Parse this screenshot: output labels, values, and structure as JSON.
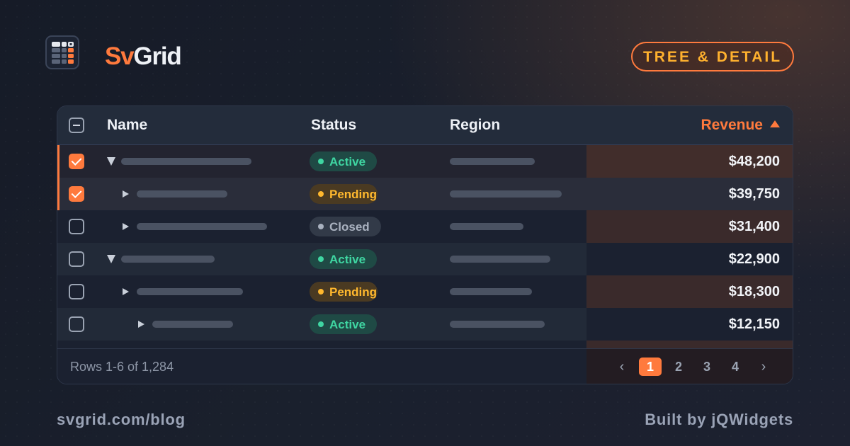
{
  "brand": {
    "accent": "Sv",
    "rest": "Grid",
    "badge": "TREE & DETAIL"
  },
  "colors": {
    "accent": "#ff7a3d",
    "badge_text": "#ffb12e",
    "active": "#3fd6a2",
    "pending": "#ffb82e",
    "closed": "#a9b1bf"
  },
  "grid": {
    "columns": {
      "name": "Name",
      "status": "Status",
      "region": "Region",
      "revenue": "Revenue"
    },
    "sort": {
      "column": "revenue",
      "direction": "asc",
      "icon": "sort-asc-icon"
    },
    "header_checkbox": "indeterminate",
    "rows": [
      {
        "checked": true,
        "expand": "expanded",
        "level": 0,
        "status": "Active",
        "status_kind": "active",
        "revenue": "$48,200"
      },
      {
        "checked": true,
        "expand": "collapsed",
        "level": 1,
        "status": "Pending",
        "status_kind": "pending",
        "revenue": "$39,750"
      },
      {
        "checked": false,
        "expand": "collapsed",
        "level": 1,
        "status": "Closed",
        "status_kind": "closed",
        "revenue": "$31,400"
      },
      {
        "checked": false,
        "expand": "expanded",
        "level": 0,
        "status": "Active",
        "status_kind": "active",
        "revenue": "$22,900"
      },
      {
        "checked": false,
        "expand": "collapsed",
        "level": 1,
        "status": "Pending",
        "status_kind": "pending",
        "revenue": "$18,300"
      },
      {
        "checked": false,
        "expand": "collapsed",
        "level": 2,
        "status": "Active",
        "status_kind": "active",
        "revenue": "$12,150"
      }
    ],
    "rows_info": "Rows 1-6 of 1,284",
    "pagination": {
      "prev": "‹",
      "next": "›",
      "pages": [
        "1",
        "2",
        "3",
        "4"
      ],
      "current": "1"
    }
  },
  "footer": {
    "left": "svgrid.com/blog",
    "right": "Built by jQWidgets"
  }
}
